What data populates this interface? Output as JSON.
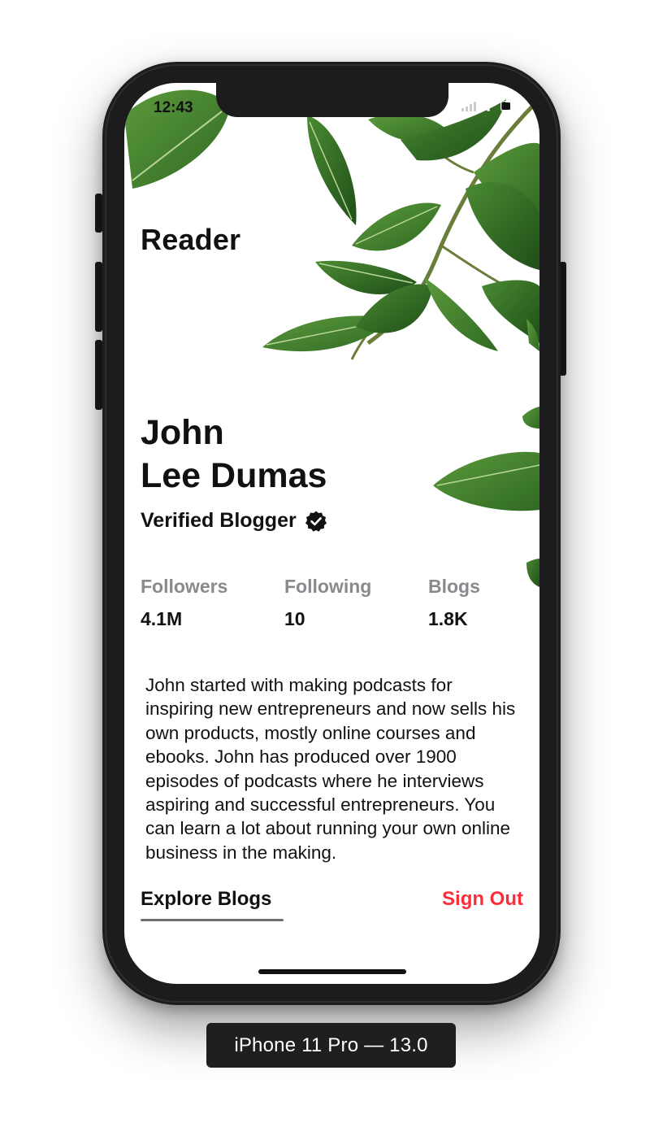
{
  "status_bar": {
    "time": "12:43",
    "icons": [
      "signal-icon",
      "wifi-icon",
      "battery-icon"
    ]
  },
  "app": {
    "title": "Reader"
  },
  "profile": {
    "first_name": "John",
    "last_name": "Lee Dumas",
    "badge_label": "Verified Blogger",
    "badge_icon": "verified-check-icon",
    "stats": [
      {
        "label": "Followers",
        "value": "4.1M"
      },
      {
        "label": "Following",
        "value": "10"
      },
      {
        "label": "Blogs",
        "value": "1.8K"
      }
    ],
    "bio": "John started with making podcasts for inspiring new entrepreneurs and now sells his own products, mostly online courses and ebooks. John has produced over 1900 episodes of podcasts where he interviews aspiring and successful entrepreneurs. You can learn a lot about running your own online business in the making."
  },
  "actions": {
    "explore_label": "Explore Blogs",
    "sign_out_label": "Sign Out"
  },
  "simulator": {
    "label": "iPhone 11 Pro — 13.0"
  },
  "colors": {
    "accent_red": "#ff2d3a",
    "text_primary": "#111111",
    "text_secondary": "#8a8a8e",
    "device_frame": "#1c1c1e",
    "leaf_green": "#3f7f2e"
  }
}
